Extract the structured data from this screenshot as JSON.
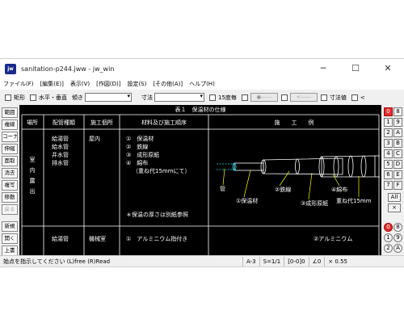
{
  "window": {
    "app_icon_text": "jw",
    "title": "sanitation-p244.jww - jw_win",
    "controls": [
      "─",
      "☐",
      "✕"
    ]
  },
  "menu": [
    "ファイル(F)",
    "[編集(E)]",
    "表示(V)",
    "[作図(D)]",
    "設定(S)",
    "[その他(A)]",
    "ヘルプ(H)"
  ],
  "toolbar": {
    "rect_label": "矩形",
    "hv_label": "水平・垂直",
    "slope_label": "傾き",
    "dim_label": "寸法",
    "deg15_label": "15度毎",
    "dimval_label": "寸法値",
    "lt_label": "<"
  },
  "left_tools": [
    "範囲",
    "複線",
    "コーナー",
    "伸縮",
    "面取",
    "消去",
    "複写",
    "移動",
    "戻る",
    "新規",
    "開く",
    "上書"
  ],
  "right_tools": {
    "col1": [
      "0",
      "1",
      "2",
      "3",
      "4",
      "5",
      "6",
      "7"
    ],
    "col2": [
      "8",
      "9",
      "A",
      "B",
      "C",
      "D",
      "E",
      "F"
    ],
    "all": "All",
    "x": "×",
    "bottom1": [
      "0",
      "1",
      "2"
    ],
    "bottom2": [
      "8",
      "9",
      "A"
    ]
  },
  "drawing": {
    "table_title": "表１　保温材の仕様",
    "headers": [
      "場所",
      "配管種類",
      "施工個所",
      "材料及び施工順序",
      "施　　工　　例"
    ],
    "row1": {
      "place": [
        "室",
        "内",
        "露",
        "出"
      ],
      "pipes": [
        "給湯管",
        "給水管",
        "井水管",
        "排水管"
      ],
      "location": "屋内",
      "materials": [
        "①　保温材",
        "②　鉄線",
        "③　成形原紙",
        "④　綿布",
        "（重ね代15mmにて）"
      ],
      "note": "＊保温の厚さは別紙参照",
      "labels": {
        "pipe": "管",
        "insulation": "①保温材",
        "wire": "②鉄線",
        "paper": "③成形原紙",
        "cloth": "④綿布",
        "overlap": "重ね代15mm"
      }
    },
    "row2": {
      "pipes": "給湯管",
      "location": "機械室",
      "materials": "①　アルミニウム指付き",
      "example": "②アルミニウム"
    }
  },
  "status": {
    "prompt": "始点を指示してください (L)free (R)Read",
    "paper": "A-3",
    "scale": "S=1/1",
    "layer": "[0-0]0",
    "angle": "∠0",
    "zoom": "× 0.55"
  },
  "colors": {
    "canvas_bg": "#000000",
    "line_white": "#ffffff",
    "pipe_cyan": "#00e5ff",
    "leader_yellow": "#ffff00"
  }
}
